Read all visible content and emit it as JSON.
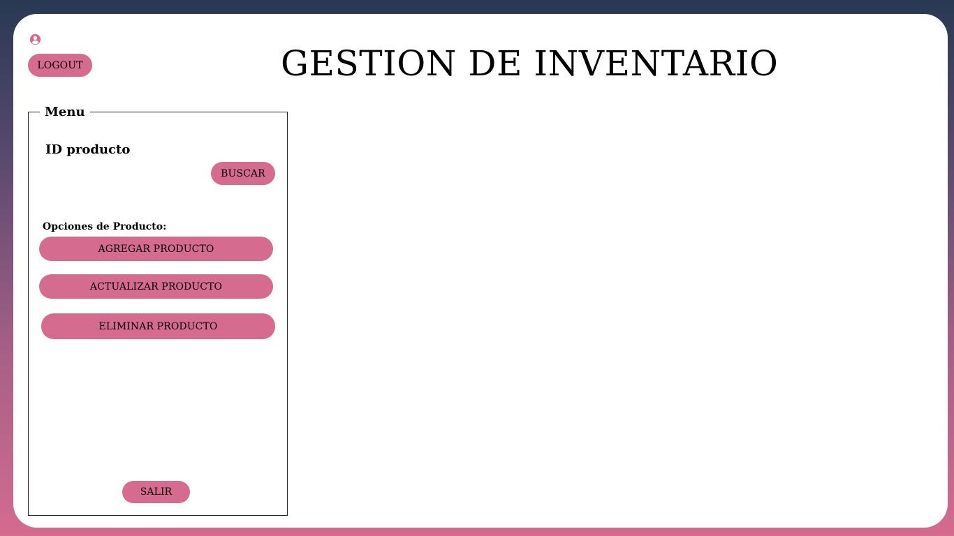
{
  "header": {
    "title": "GESTION DE INVENTARIO",
    "logout_label": "LOGOUT",
    "user_icon": "user-circle-icon"
  },
  "menu": {
    "legend": "Menu",
    "id_label": "ID producto",
    "search_label": "BUSCAR",
    "options_label": "Opciones de Producto:",
    "add_label": "AGREGAR PRODUCTO",
    "update_label": "ACTUALIZAR PRODUCTO",
    "delete_label": "ELIMINAR PRODUCTO",
    "exit_label": "SALIR"
  },
  "colors": {
    "accent": "#d56b8f",
    "background_top": "#293853",
    "background_bottom": "#d56b8f",
    "card": "#ffffff"
  }
}
